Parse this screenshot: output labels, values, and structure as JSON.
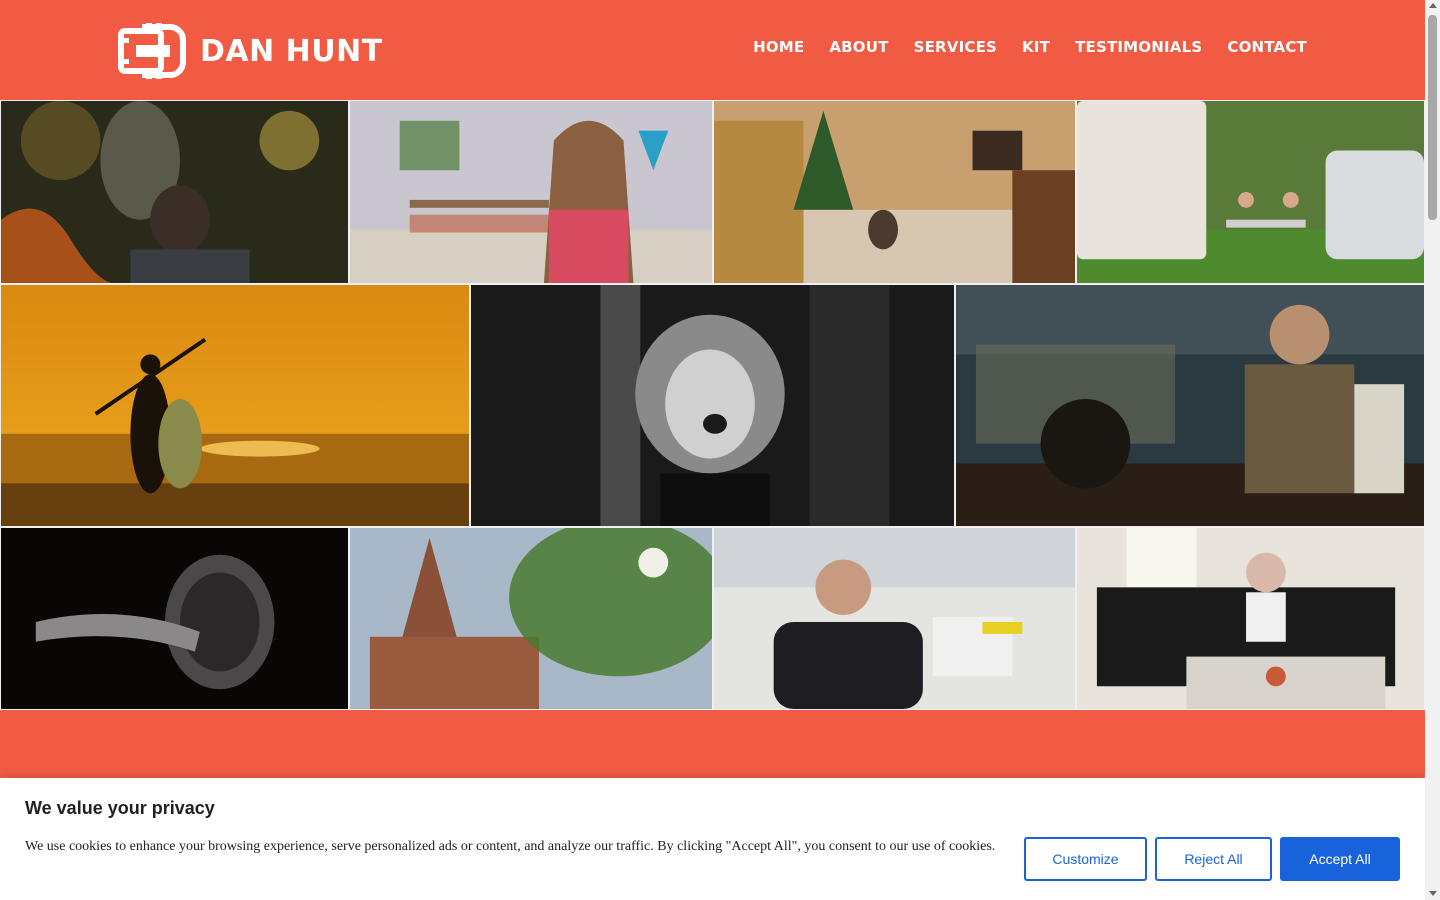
{
  "header": {
    "brand": "DAN HUNT",
    "nav": [
      "HOME",
      "ABOUT",
      "SERVICES",
      "KIT",
      "TESTIMONIALS",
      "CONTACT"
    ]
  },
  "colors": {
    "brand": "#f15b43",
    "button_blue": "#1863dc"
  },
  "gallery": {
    "tiles": [
      {
        "name": "tile-artist-painting",
        "icon": "photo"
      },
      {
        "name": "tile-woman-playroom",
        "icon": "photo"
      },
      {
        "name": "tile-dog-christmas",
        "icon": "photo"
      },
      {
        "name": "tile-caravan-picnic",
        "icon": "photo"
      },
      {
        "name": "tile-paddleboard-sunset",
        "icon": "photo"
      },
      {
        "name": "tile-singer-bw",
        "icon": "photo"
      },
      {
        "name": "tile-barman-pub",
        "icon": "photo"
      },
      {
        "name": "tile-door-handle",
        "icon": "photo"
      },
      {
        "name": "tile-church-trees",
        "icon": "photo"
      },
      {
        "name": "tile-man-lab",
        "icon": "photo"
      },
      {
        "name": "tile-man-messy-room",
        "icon": "photo"
      }
    ]
  },
  "cookie": {
    "title": "We value your privacy",
    "body": "We use cookies to enhance your browsing experience, serve personalized ads or content, and analyze our traffic. By clicking \"Accept All\", you consent to our use of cookies.",
    "customize": "Customize",
    "reject": "Reject All",
    "accept": "Accept All"
  }
}
